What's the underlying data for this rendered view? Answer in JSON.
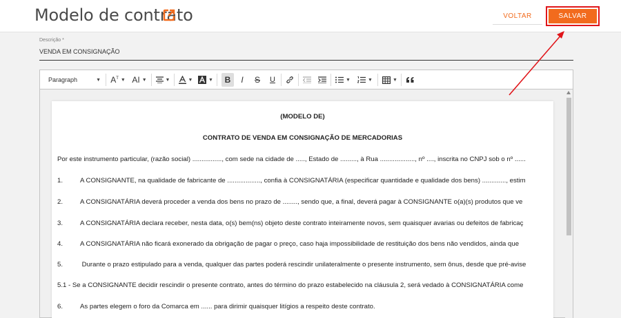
{
  "header": {
    "title": "Modelo de contrato",
    "voltar_label": "VOLTAR",
    "salvar_label": "SALVAR"
  },
  "field": {
    "label": "Descrição *",
    "value": "VENDA EM CONSIGNAÇÃO"
  },
  "toolbar": {
    "paragraph_label": "Paragraph",
    "font_size_label": "A",
    "font_family_label": "AI"
  },
  "document": {
    "heading1": "(MODELO DE)",
    "heading2": "CONTRATO DE VENDA EM CONSIGNAÇÃO DE MERCADORIAS",
    "intro": "Por este instrumento particular, (razão social) ................, com sede na cidade de ....., Estado de ........., à Rua ..................., nº ...., inscrita no CNPJ sob o nº ......",
    "items": [
      {
        "num": "1.",
        "text": "A CONSIGNANTE, na qualidade de fabricante de .................., confia à CONSIGNATÁRIA (especificar quantidade e qualidade dos bens) ............., estim"
      },
      {
        "num": "2.",
        "text": "A CONSIGNATÁRIA deverá proceder a venda dos bens no prazo de ........, sendo que, a final, deverá pagar à CONSIGNANTE o(a)(s) produtos que ve"
      },
      {
        "num": "3.",
        "text": "A CONSIGNATÁRIA declara receber, nesta data, o(s) bem(ns) objeto deste contrato inteiramente novos, sem quaisquer avarias ou defeitos de fabricaç"
      },
      {
        "num": "4.",
        "text": "A CONSIGNATÁRIA não ficará exonerado da obrigação de pagar o preço, caso haja  impossibilidade de restituição dos bens não vendidos, ainda que"
      },
      {
        "num": "5.",
        "text": " Durante o prazo estipulado para a venda, qualquer das partes poderá rescindir unilateralmente o presente instrumento, sem ônus, desde que pré-avise"
      }
    ],
    "item51": "5.1 - Se a CONSIGNANTE decidir rescindir o presente contrato, antes do término do prazo estabelecido na cláusula 2, será vedado à CONSIGNATÁRIA come",
    "item6": {
      "num": "6.",
      "text": "As partes elegem o foro da Comarca em ...... para dirimir quaisquer litígios a respeito deste contrato."
    }
  },
  "colors": {
    "accent": "#f26b1d",
    "highlight": "#e0151a"
  },
  "icons": [
    "external-link-icon",
    "text-size-icon",
    "font-family-icon",
    "align-icon",
    "font-color-icon",
    "highlight-color-icon",
    "bold-icon",
    "italic-icon",
    "strikethrough-icon",
    "underline-icon",
    "link-icon",
    "outdent-icon",
    "indent-icon",
    "bulleted-list-icon",
    "numbered-list-icon",
    "table-icon",
    "blockquote-icon"
  ]
}
